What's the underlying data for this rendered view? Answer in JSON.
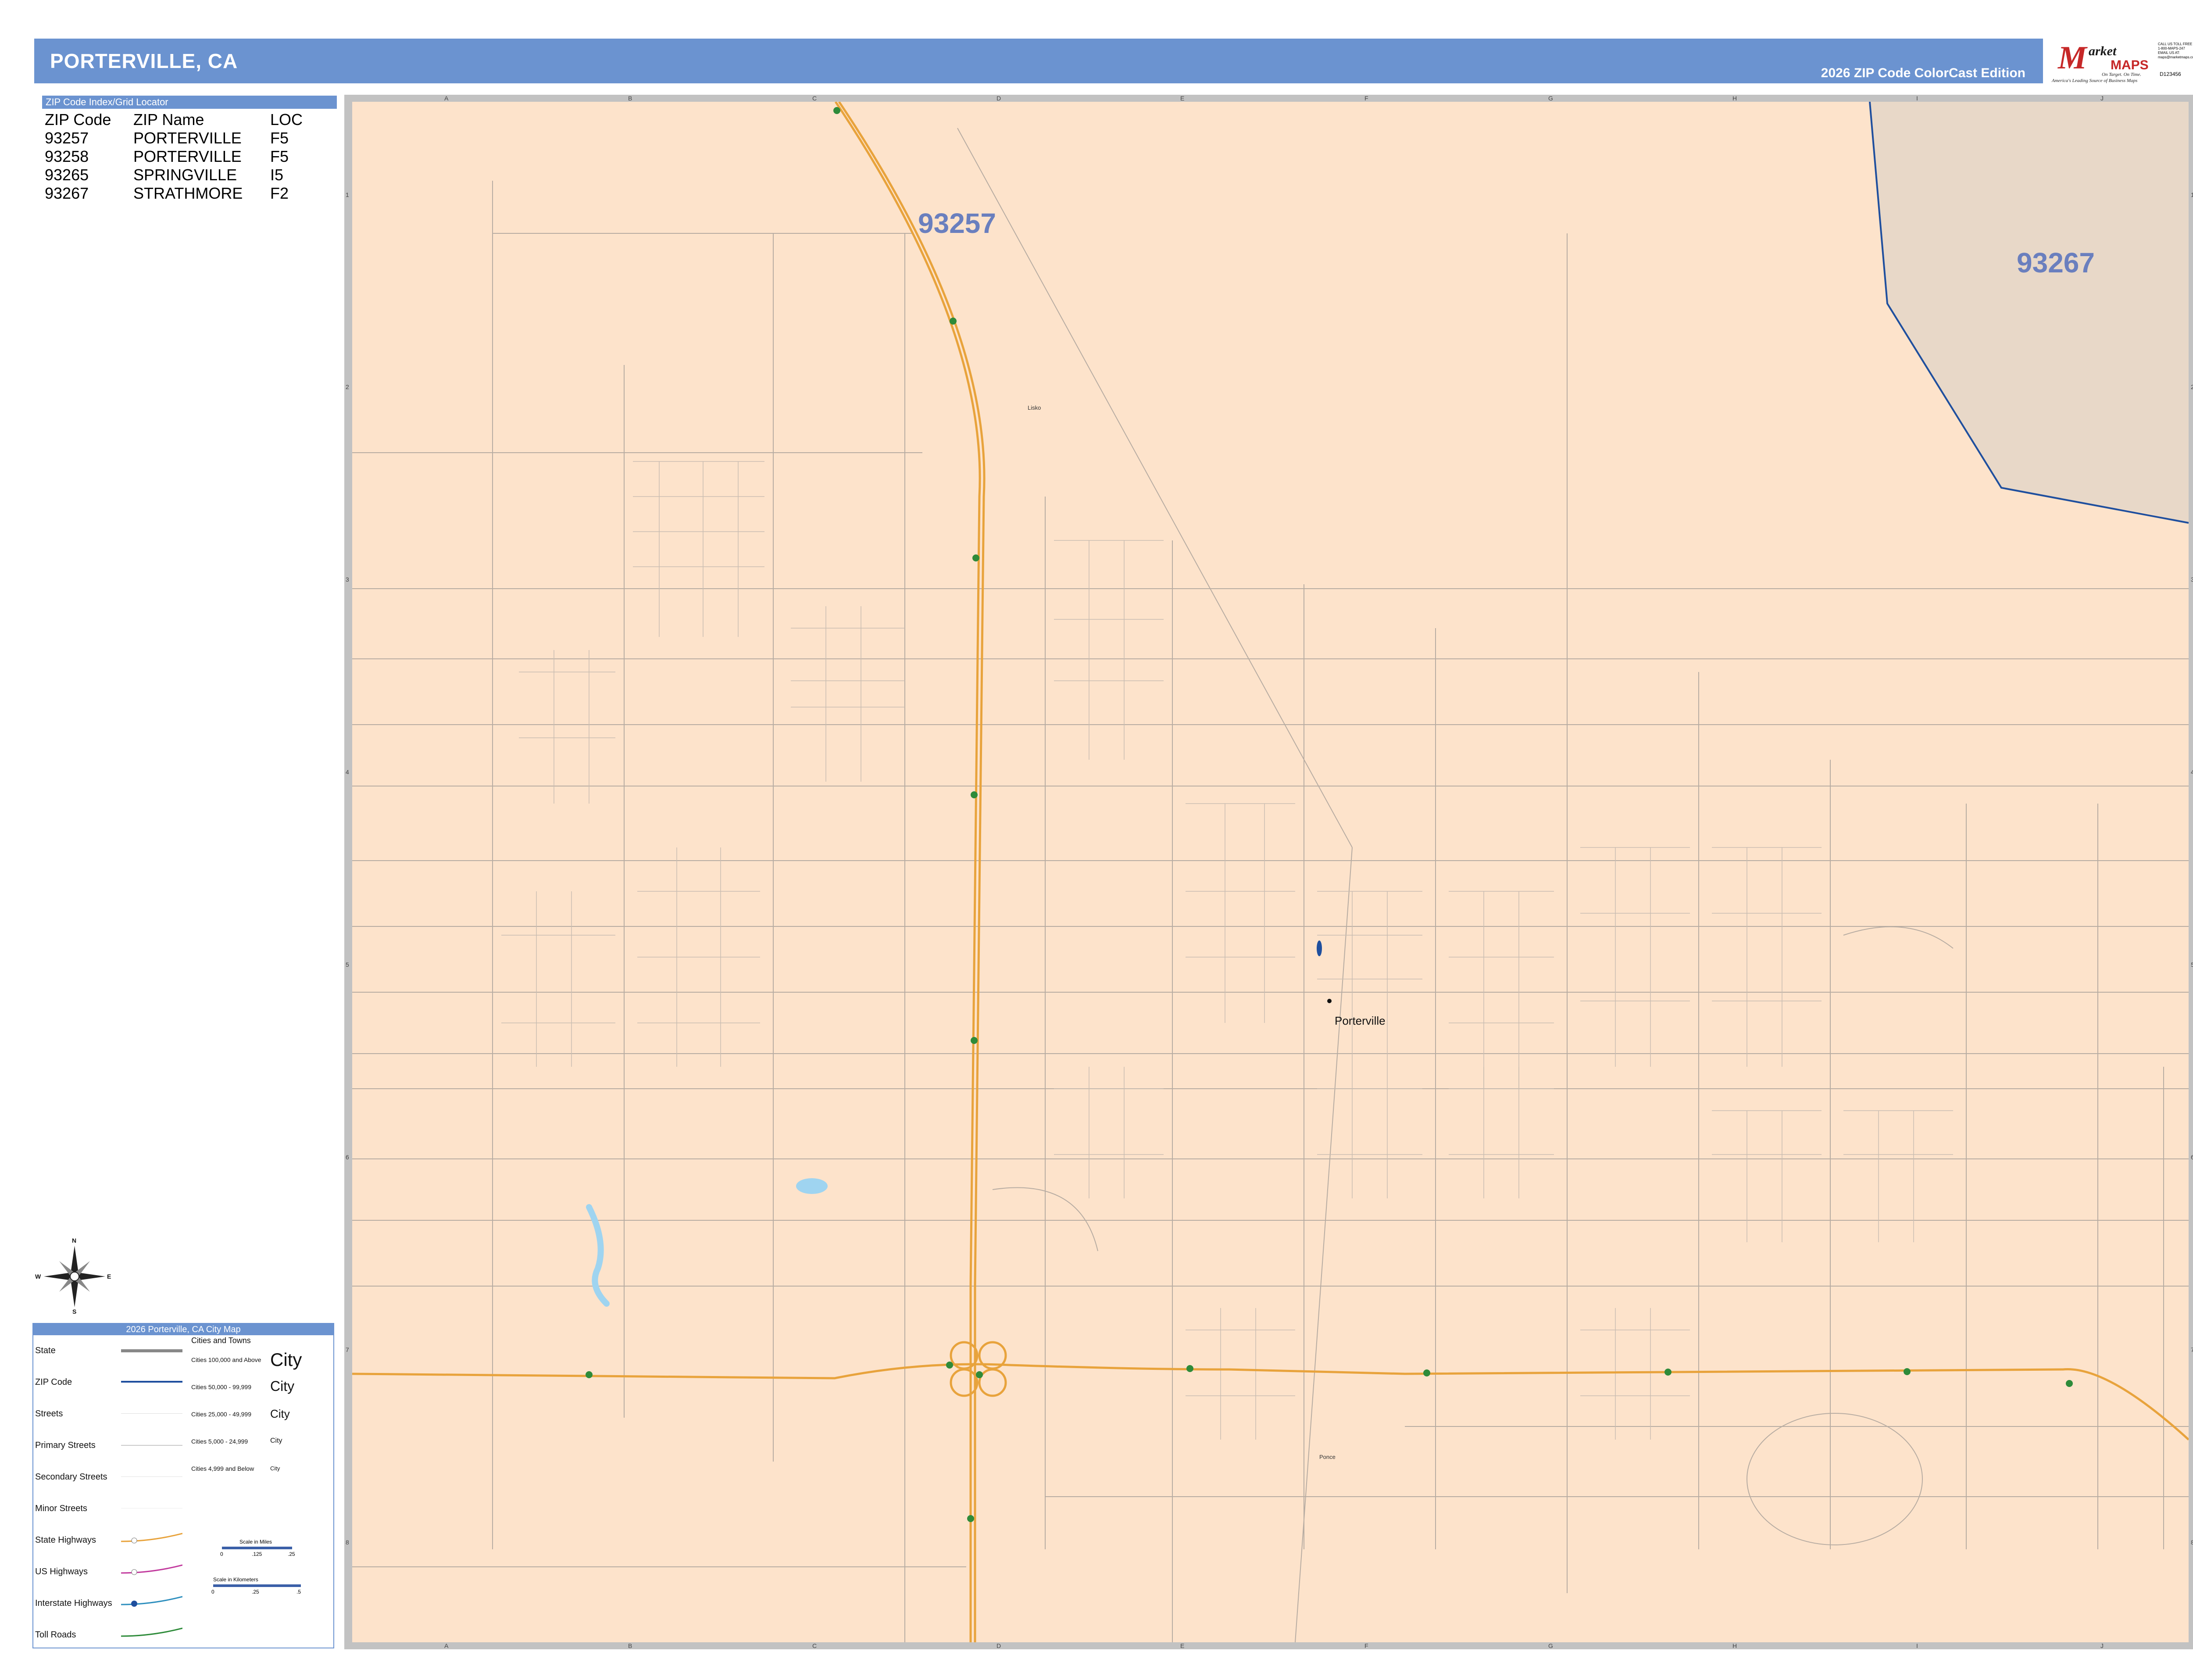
{
  "header": {
    "title": "PORTERVILLE, CA",
    "edition": "2026 ZIP Code ColorCast Edition"
  },
  "logo": {
    "m": "M",
    "market": "arket",
    "maps": "MAPS",
    "tagline1": "On Target. On Time.",
    "tagline2": "America's Leading Source of Business Maps",
    "phone_lines": [
      "CALL US TOLL FREE",
      "1-800-MAPS-247",
      "",
      "EMAIL US AT:",
      "maps@marketmaps.com"
    ],
    "code": "D123456"
  },
  "index": {
    "header": "ZIP Code Index/Grid Locator",
    "columns": [
      "ZIP Code",
      "ZIP Name",
      "LOC"
    ],
    "rows": [
      [
        "93257",
        "PORTERVILLE",
        "F5"
      ],
      [
        "93258",
        "PORTERVILLE",
        "F5"
      ],
      [
        "93265",
        "SPRINGVILLE",
        "I5"
      ],
      [
        "93267",
        "STRATHMORE",
        "F2"
      ]
    ]
  },
  "map": {
    "grid_letters": [
      "A",
      "B",
      "C",
      "D",
      "E",
      "F",
      "G",
      "H",
      "I",
      "J"
    ],
    "grid_numbers": [
      "1",
      "2",
      "3",
      "4",
      "5",
      "6",
      "7",
      "8"
    ],
    "zip_labels": [
      "93257",
      "93267"
    ],
    "city_label": "Porterville",
    "place_labels": [
      "Lisko",
      "Ponce"
    ],
    "colors": {
      "land": "#fde3cb",
      "zip_93267": "#e8d8c8",
      "zip_boundary": "#1f4f9e",
      "highway": "#e8a33c",
      "streets": "#b0a69c",
      "water": "#9fd4f0",
      "frame": "#c2c2c2"
    }
  },
  "compass": {
    "n": "N",
    "s": "S",
    "e": "E",
    "w": "W"
  },
  "legend": {
    "title": "2026 Porterville, CA City Map",
    "items": [
      "State",
      "ZIP Code",
      "Streets",
      "Primary Streets",
      "Secondary Streets",
      "Minor Streets",
      "State Highways",
      "US Highways",
      "Interstate Highways",
      "Toll Roads"
    ],
    "cities_header": "Cities and Towns",
    "city_classes": [
      {
        "label": "Cities 100,000 and Above",
        "sample": "City"
      },
      {
        "label": "Cities 50,000 - 99,999",
        "sample": "City"
      },
      {
        "label": "Cities 25,000 - 49,999",
        "sample": "City"
      },
      {
        "label": "Cities 5,000 - 24,999",
        "sample": "City"
      },
      {
        "label": "Cities 4,999 and Below",
        "sample": "City"
      }
    ],
    "scale_miles_label": "Scale in Miles",
    "scale_miles_ticks": [
      "0",
      ".125",
      ".25"
    ],
    "scale_km_label": "Scale in Kilometers",
    "scale_km_ticks": [
      "0",
      ".25",
      ".5"
    ]
  }
}
